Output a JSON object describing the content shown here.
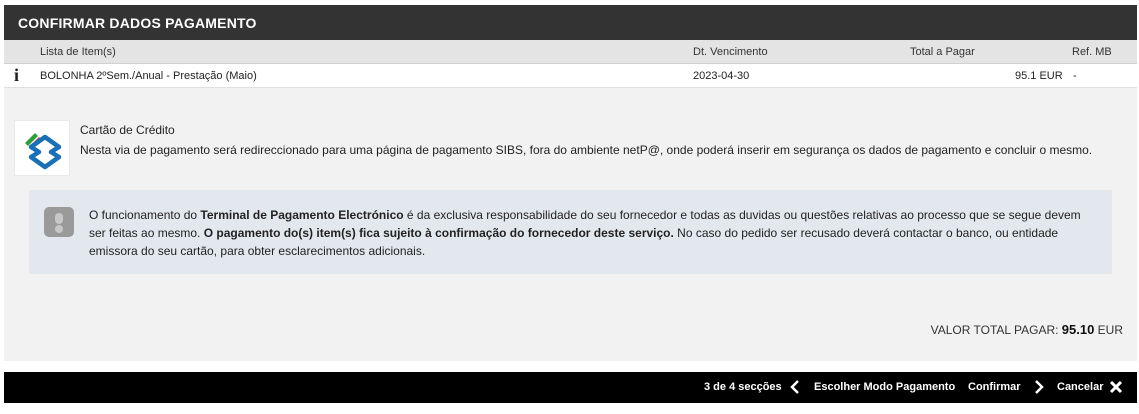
{
  "header": {
    "title": "CONFIRMAR DADOS PAGAMENTO"
  },
  "table": {
    "columns": [
      "Lista de Item(s)",
      "Dt. Vencimento",
      "Total a Pagar",
      "Ref. MB"
    ],
    "rows": [
      {
        "info_icon": "i",
        "item": "BOLONHA 2ºSem./Anual - Prestação (Maio)",
        "due_date": "2023-04-30",
        "total": "95.1 EUR",
        "ref_mb": "-"
      }
    ]
  },
  "payment_method": {
    "logo_icon": "sibs-logo-icon",
    "title": "Cartão de Crédito",
    "description": "Nesta via de pagamento será redireccionado para uma página de pagamento SIBS, fora do ambiente netP@, onde poderá inserir em segurança os dados de pagamento e concluir o mesmo."
  },
  "notice": {
    "icon": "exclamation-icon",
    "t1": "O funcionamento do ",
    "b1": "Terminal de Pagamento Electrónico",
    "t2": " é da exclusiva responsabilidade do seu fornecedor e todas as duvidas ou questões relativas ao processo que se segue devem ser feitas ao mesmo. ",
    "b2": "O pagamento do(s) item(s) fica sujeito à confirmação do fornecedor deste serviço.",
    "t3": " No caso do pedido ser recusado deverá contactar o banco, ou entidade emissora do seu cartão, para obter esclarecimentos adicionais."
  },
  "total": {
    "label": "VALOR TOTAL PAGAR: ",
    "amount": "95.10",
    "currency": " EUR"
  },
  "footer": {
    "step": "3 de 4 secções",
    "back_icon": "chevron-left-icon",
    "back_label": "Escolher Modo Pagamento",
    "confirm_label": "Confirmar",
    "confirm_icon": "chevron-right-icon",
    "cancel_label": "Cancelar",
    "cancel_icon": "close-icon"
  }
}
